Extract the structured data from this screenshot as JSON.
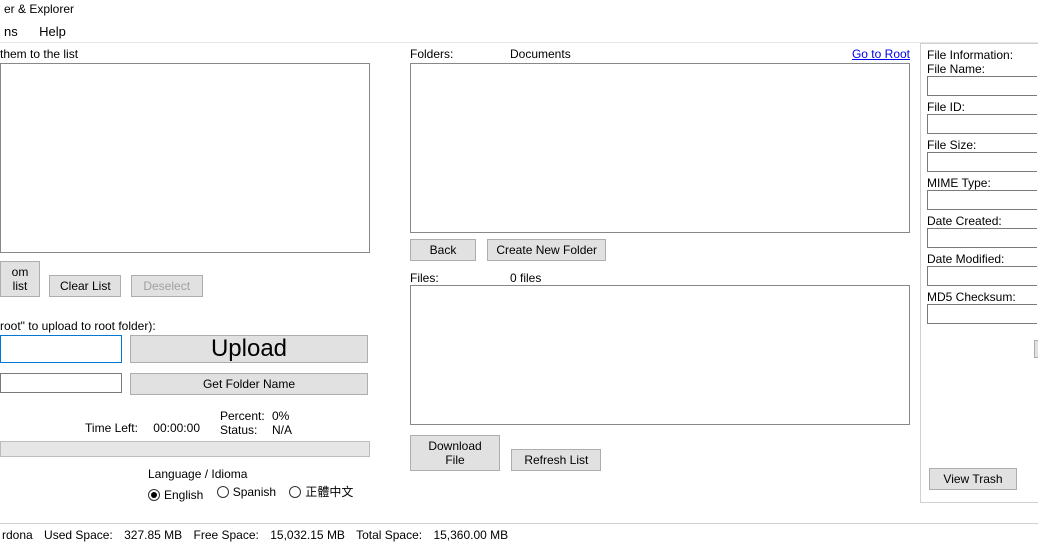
{
  "window": {
    "title": "er & Explorer"
  },
  "menu": {
    "item1": "ns",
    "item2": "Help"
  },
  "left": {
    "drop_label": "them to the list",
    "btn_remove": "om list",
    "btn_clear": "Clear List",
    "btn_deselect": "Deselect",
    "folder_hint": "root\" to upload to root folder):",
    "btn_upload": "Upload",
    "btn_getfolder": "Get Folder Name",
    "time_left_label": "Time Left:",
    "time_left_value": "00:00:00",
    "percent_label": "Percent:",
    "percent_value": "0%",
    "status_label": "Status:",
    "status_value": "N/A",
    "lang_group": "Language / Idioma",
    "lang_en": "English",
    "lang_es": "Spanish",
    "lang_zh": "正體中文"
  },
  "mid": {
    "folders_label": "Folders:",
    "current_folder": "Documents",
    "goto_root": "Go to Root",
    "btn_back": "Back",
    "btn_newfolder": "Create New Folder",
    "files_label": "Files:",
    "files_count": "0 files",
    "btn_download": "Download File",
    "btn_refresh": "Refresh List"
  },
  "right": {
    "group": "File Information:",
    "fname": "File Name:",
    "fid": "File ID:",
    "fsize": "File Size:",
    "mime": "MIME Type:",
    "dcreated": "Date Created:",
    "dmodified": "Date Modified:",
    "md5": "MD5 Checksum:",
    "btn_trash": "View Trash"
  },
  "status": {
    "user": "rdona",
    "used_label": "Used Space:",
    "used_val": "327.85 MB",
    "free_label": "Free Space:",
    "free_val": "15,032.15 MB",
    "total_label": "Total Space:",
    "total_val": "15,360.00 MB"
  }
}
